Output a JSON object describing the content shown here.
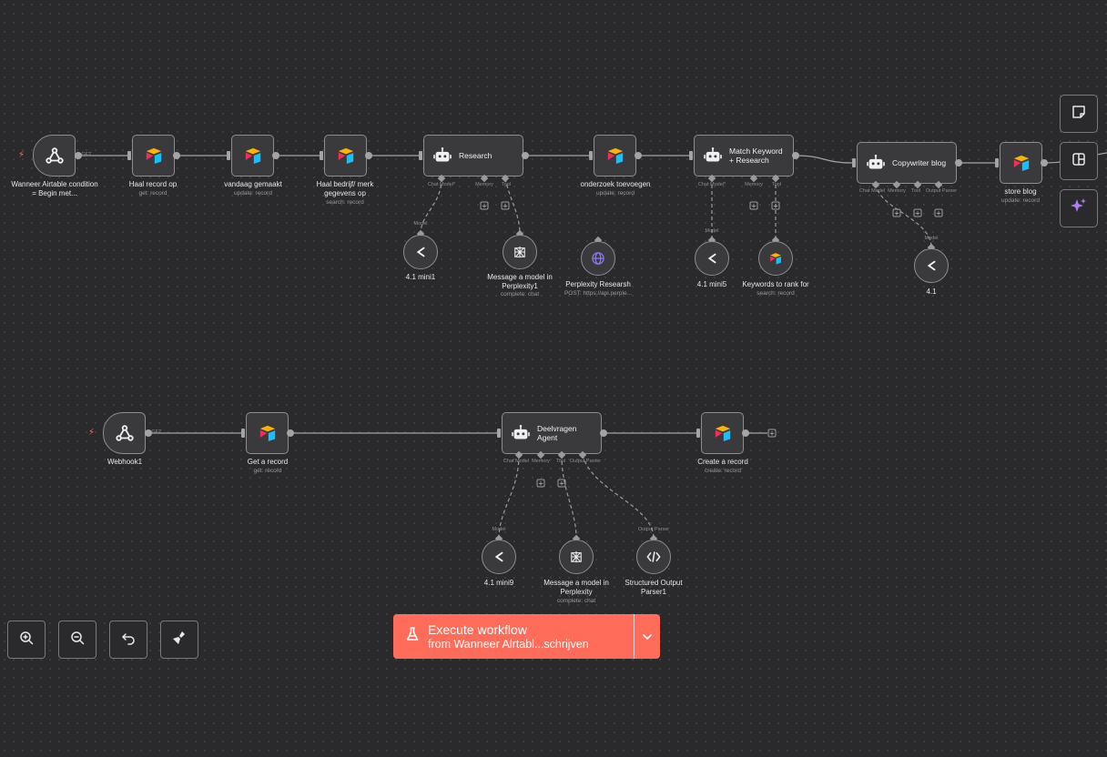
{
  "canvas": {
    "nodes": {
      "trigger_airtable": {
        "label": "Wanneer Airtable condition = Begin met...",
        "badge": "GET"
      },
      "haal_record": {
        "label": "Haal record op",
        "sub": "get: record"
      },
      "vandaag": {
        "label": "vandaag gemaakt",
        "sub": "update: record"
      },
      "haal_bedrijf": {
        "label": "Haal bedrijf/ merk gegevens op",
        "sub": "search: record"
      },
      "research": {
        "label": "Research",
        "ports": [
          "Chat Model*",
          "Memory",
          "Tool"
        ]
      },
      "onderzoek": {
        "label": "onderzoek toevoegen",
        "sub": "update: record"
      },
      "match_keyword": {
        "label": "Match Keyword + Research",
        "ports": [
          "Chat Model*",
          "Memory",
          "Tool"
        ]
      },
      "copywriter": {
        "label": "Copywriter blog",
        "ports": [
          "Chat Model",
          "Memory",
          "Tool",
          "Output Parser"
        ]
      },
      "store_blog": {
        "label": "store blog",
        "sub": "update: record"
      },
      "mini1": {
        "label": "4.1 mini1",
        "tag": "Model"
      },
      "perplexity1": {
        "label": "Message a model in Perplexity1",
        "sub": "complete: chat"
      },
      "perplexity_research": {
        "label": "Perplexity Researsh",
        "sub": "POST: https://api.perple..."
      },
      "mini5": {
        "label": "4.1 mini5",
        "tag": "Model"
      },
      "keywords": {
        "label": "Keywords to rank for",
        "sub": "search: record"
      },
      "model41": {
        "label": "4.1",
        "tag": "Model"
      },
      "webhook1": {
        "label": "Webhook1",
        "badge": "GET"
      },
      "get_record": {
        "label": "Get a record",
        "sub": "get: record"
      },
      "deelvragen": {
        "label": "Deelvragen Agent",
        "ports": [
          "Chat Model",
          "Memory",
          "Tool",
          "Output Parser"
        ]
      },
      "create_record": {
        "label": "Create a record",
        "sub": "create: record"
      },
      "mini9": {
        "label": "4.1 mini9",
        "tag": "Model"
      },
      "perplexity": {
        "label": "Message a model in Perplexity",
        "sub": "complete: chat"
      },
      "structured": {
        "label": "Structured Output Parser1",
        "tag": "Output Parser"
      }
    }
  },
  "execute": {
    "title": "Execute workflow",
    "subtitle": "from Wanneer Alrtabl...schrijven"
  },
  "sidebar_icons": [
    "sticky-note-icon",
    "panel-layout-icon",
    "ai-sparkle-icon"
  ],
  "zoom_icons": [
    "zoom-in-icon",
    "zoom-out-icon",
    "undo-icon",
    "clean-up-icon"
  ],
  "colors": {
    "accent": "#ff6d5a",
    "background": "#2a2a2c",
    "node": "#3a3a3d",
    "sparkle": "#b07cf5"
  }
}
